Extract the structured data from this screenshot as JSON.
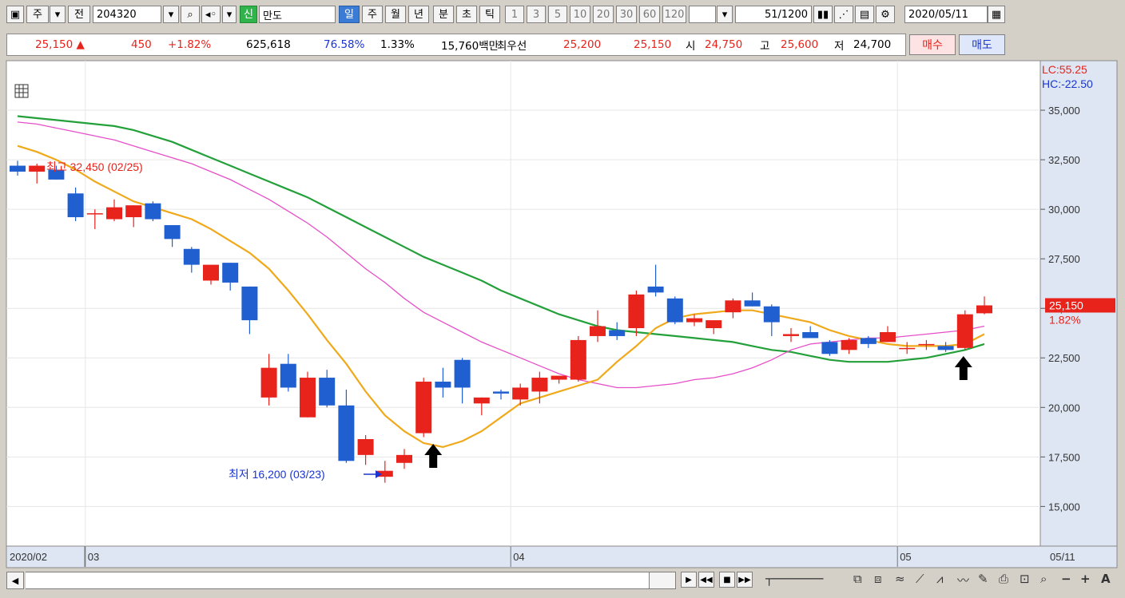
{
  "toolbar": {
    "type_label": "주",
    "prev_label": "전",
    "code": "204320",
    "cat_badge": "신",
    "stock_name": "만도",
    "periods": [
      "일",
      "주",
      "월",
      "년"
    ],
    "ticks": [
      "분",
      "초",
      "틱"
    ],
    "nums": [
      "1",
      "3",
      "5",
      "10",
      "20",
      "30",
      "60",
      "120"
    ],
    "count_value": "51",
    "count_total": "/1200",
    "date": "2020/05/11"
  },
  "quote": {
    "price": "25,150",
    "change_arrow": "▲",
    "change": "450",
    "change_pct": "+1.82%",
    "volume": "625,618",
    "vol_ratio": "76.58%",
    "turnover": "1.33%",
    "amount": "15,760백만",
    "best_label": "최우선",
    "best_ask": "25,200",
    "best_bid": "25,150",
    "open_label": "시",
    "open": "24,750",
    "high_label": "고",
    "high": "25,600",
    "low_label": "저",
    "low": "24,700",
    "buy_label": "매수",
    "sell_label": "매도"
  },
  "chart_data": {
    "type": "candlestick",
    "x_start_label": "2020/02",
    "x_labels": [
      {
        "i": 4,
        "label": "03"
      },
      {
        "i": 26,
        "label": "04"
      },
      {
        "i": 46,
        "label": "05"
      }
    ],
    "x_end_label": "05/11",
    "y_ticks": [
      15000,
      17500,
      20000,
      22500,
      25000,
      27500,
      30000,
      32500,
      35000
    ],
    "y_tick_labels": [
      "15,000",
      "17,500",
      "20,000",
      "22,500",
      "25,000",
      "27,500",
      "30,000",
      "32,500",
      "35,000"
    ],
    "ylim": [
      13000,
      37500
    ],
    "right_labels": [
      "LC:55.25",
      "HC:-22.50"
    ],
    "current_label": "25,150",
    "current_value": 25150,
    "current_pct": "1.82%",
    "annotation_high": "최고 32,450 (02/25)",
    "annotation_low": "최저 16,200 (03/23)",
    "up_color": "#e8231c",
    "down_color": "#1f5fd0",
    "ma_colors": [
      "#f0a91b",
      "#e64fc8",
      "#23a03a"
    ],
    "candles": [
      [
        32200,
        32450,
        31700,
        31900
      ],
      [
        31900,
        32300,
        31300,
        32200
      ],
      [
        32000,
        32200,
        31500,
        31500
      ],
      [
        30800,
        31100,
        29400,
        29600
      ],
      [
        29800,
        30000,
        29000,
        29800
      ],
      [
        29500,
        30500,
        29400,
        30100
      ],
      [
        29600,
        30200,
        29100,
        30200
      ],
      [
        30300,
        30400,
        29400,
        29500
      ],
      [
        29200,
        29200,
        28100,
        28500
      ],
      [
        28000,
        28100,
        26800,
        27200
      ],
      [
        26400,
        27200,
        26200,
        27200
      ],
      [
        27300,
        27300,
        25900,
        26300
      ],
      [
        26100,
        26100,
        23700,
        24400
      ],
      [
        20500,
        22700,
        20100,
        22000
      ],
      [
        22200,
        22700,
        20800,
        21000
      ],
      [
        19500,
        21800,
        19500,
        21500
      ],
      [
        21500,
        21900,
        20000,
        20100
      ],
      [
        20100,
        20900,
        17200,
        17300
      ],
      [
        17600,
        18600,
        17100,
        18400
      ],
      [
        16500,
        17300,
        16200,
        16800
      ],
      [
        17200,
        17900,
        16900,
        17600
      ],
      [
        18700,
        21500,
        18500,
        21300
      ],
      [
        21300,
        22000,
        20500,
        21000
      ],
      [
        22400,
        22500,
        20200,
        21000
      ],
      [
        20200,
        20500,
        19600,
        20500
      ],
      [
        20800,
        20900,
        20400,
        20700
      ],
      [
        20400,
        21200,
        20100,
        21000
      ],
      [
        20800,
        21800,
        20200,
        21500
      ],
      [
        21400,
        21600,
        21200,
        21600
      ],
      [
        21400,
        23600,
        21300,
        23400
      ],
      [
        23600,
        24900,
        23300,
        24100
      ],
      [
        23900,
        24300,
        23400,
        23600
      ],
      [
        24000,
        25900,
        23600,
        25700
      ],
      [
        26100,
        27200,
        25600,
        25800
      ],
      [
        25500,
        25600,
        24200,
        24300
      ],
      [
        24300,
        24700,
        24100,
        24500
      ],
      [
        24000,
        24300,
        23700,
        24400
      ],
      [
        24800,
        25500,
        24500,
        25400
      ],
      [
        25400,
        25800,
        25100,
        25100
      ],
      [
        25100,
        25200,
        23600,
        24300
      ],
      [
        23600,
        24000,
        23300,
        23700
      ],
      [
        23800,
        24100,
        23600,
        23500
      ],
      [
        23300,
        23400,
        22600,
        22700
      ],
      [
        22900,
        23500,
        22700,
        23400
      ],
      [
        23500,
        23600,
        23000,
        23200
      ],
      [
        23300,
        24100,
        23300,
        23800
      ],
      [
        23000,
        23300,
        22700,
        23000
      ],
      [
        23200,
        23400,
        22900,
        23200
      ],
      [
        23100,
        23300,
        22800,
        22900
      ],
      [
        23000,
        24900,
        22900,
        24700
      ],
      [
        24750,
        25600,
        24700,
        25150
      ]
    ],
    "ma5": [
      33200,
      32900,
      32500,
      32000,
      31400,
      30900,
      30400,
      30100,
      29800,
      29500,
      29000,
      28400,
      27800,
      27000,
      25900,
      24700,
      23400,
      22200,
      20800,
      19600,
      18800,
      18200,
      18000,
      18300,
      18800,
      19500,
      20200,
      20500,
      20800,
      21100,
      21400,
      22300,
      23100,
      24000,
      24500,
      24700,
      24800,
      24900,
      24900,
      24700,
      24500,
      24300,
      23900,
      23600,
      23400,
      23200,
      23100,
      23100,
      23100,
      23200,
      23700
    ],
    "ma20": [
      34400,
      34300,
      34100,
      33900,
      33700,
      33500,
      33200,
      32900,
      32600,
      32300,
      31900,
      31500,
      31000,
      30500,
      29900,
      29300,
      28600,
      27800,
      27000,
      26300,
      25500,
      24800,
      24300,
      23800,
      23300,
      22900,
      22500,
      22100,
      21700,
      21400,
      21200,
      21000,
      21000,
      21100,
      21200,
      21400,
      21500,
      21700,
      22000,
      22400,
      22900,
      23200,
      23300,
      23400,
      23500,
      23500,
      23600,
      23700,
      23800,
      23900,
      24100
    ],
    "ma60": [
      34700,
      34600,
      34500,
      34400,
      34300,
      34200,
      34000,
      33700,
      33400,
      33000,
      32600,
      32200,
      31800,
      31400,
      31000,
      30600,
      30100,
      29600,
      29100,
      28600,
      28100,
      27600,
      27200,
      26800,
      26400,
      25900,
      25500,
      25100,
      24700,
      24400,
      24100,
      23900,
      23800,
      23700,
      23600,
      23500,
      23400,
      23300,
      23100,
      22900,
      22800,
      22600,
      22400,
      22300,
      22300,
      22300,
      22400,
      22500,
      22700,
      22900,
      23200
    ]
  }
}
